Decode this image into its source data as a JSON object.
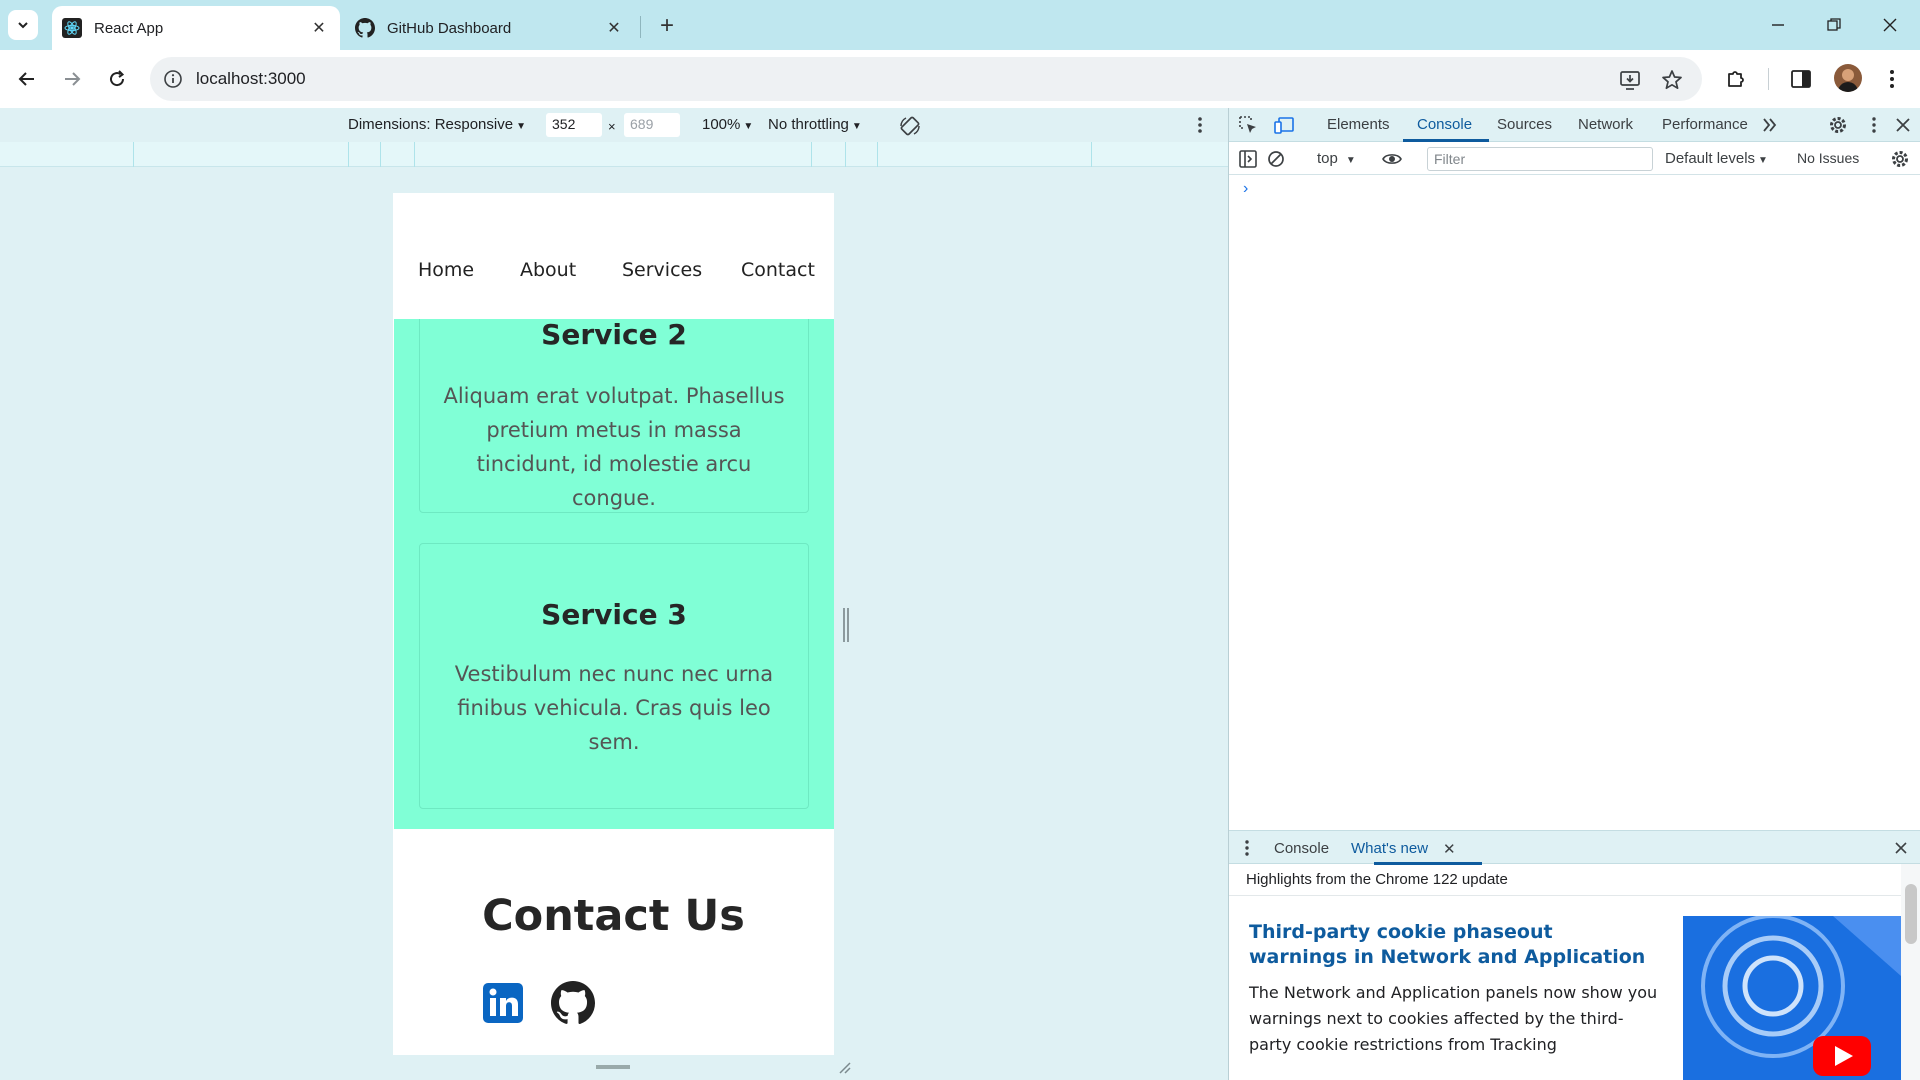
{
  "browser": {
    "tabs": [
      {
        "title": "React App",
        "active": true
      },
      {
        "title": "GitHub Dashboard",
        "active": false
      }
    ],
    "url": "localhost:3000"
  },
  "device_toolbar": {
    "dimensions_label": "Dimensions: Responsive",
    "width_value": "352",
    "height_placeholder": "689",
    "times": "×",
    "zoom": "100%",
    "throttling": "No throttling"
  },
  "page": {
    "nav": [
      "Home",
      "About",
      "Services",
      "Contact"
    ],
    "services": [
      {
        "title": "Service 2",
        "text": "Aliquam erat volutpat. Phasellus pretium metus in massa tincidunt, id molestie arcu congue."
      },
      {
        "title": "Service 3",
        "text": "Vestibulum nec nunc nec urna finibus vehicula. Cras quis leo sem."
      }
    ],
    "contact_title": "Contact Us",
    "social_icons": [
      "linkedin-icon",
      "github-icon"
    ],
    "colors": {
      "services_bg": "#80ffd6",
      "linkedin": "#0a66c2"
    }
  },
  "devtools": {
    "tabs": [
      "Elements",
      "Console",
      "Sources",
      "Network",
      "Performance"
    ],
    "active_tab": "Console",
    "context": "top",
    "filter_placeholder": "Filter",
    "levels": "Default levels",
    "issues": "No Issues",
    "prompt": "›",
    "drawer": {
      "tabs": [
        "Console",
        "What's new"
      ],
      "active_tab": "What's new",
      "highlights": "Highlights from the Chrome 122 update",
      "article_title": "Third-party cookie phaseout warnings in Network and Application",
      "article_body": "The Network and Application panels now show you warnings next to cookies affected by the third-party cookie restrictions from Tracking"
    }
  }
}
